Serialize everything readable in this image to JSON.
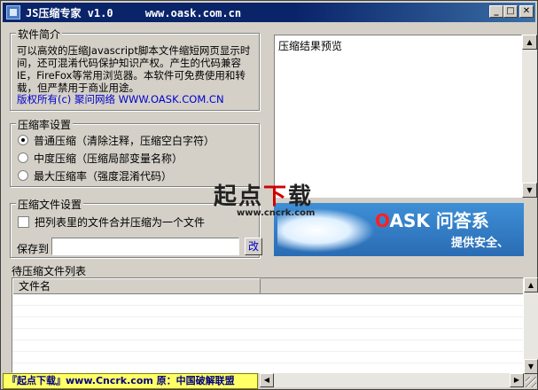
{
  "window": {
    "title": "JS压缩专家 v1.0     www.oask.com.cn",
    "controls": {
      "minimize": "_",
      "maximize": "□",
      "close": "✕"
    }
  },
  "intro": {
    "group_title": "软件简介",
    "text": "可以高效的压缩Javascript脚本文件缩短网页显示时间，还可混淆代码保护知识产权。产生的代码兼容IE，FireFox等常用浏览器。本软件可免费使用和转载，但严禁用于商业用途。",
    "copyright": "版权所有(c) 聚问网络 WWW.OASK.COM.CN"
  },
  "compression": {
    "group_title": "压缩率设置",
    "options": [
      {
        "label": "普通压缩（清除注释，压缩空白字符）",
        "selected": true
      },
      {
        "label": "中度压缩（压缩局部变量名称）",
        "selected": false
      },
      {
        "label": "最大压缩率（强度混淆代码）",
        "selected": false
      }
    ]
  },
  "file_settings": {
    "group_title": "压缩文件设置",
    "merge_label": "把列表里的文件合并压缩为一个文件",
    "merge_checked": false,
    "save_to_label": "保存到",
    "save_to_value": "",
    "change_button": "改"
  },
  "preview": {
    "label": "压缩结果预览"
  },
  "banner": {
    "brand_prefix": "O",
    "brand_rest": "ASK 问答系",
    "subtitle": "提供安全、"
  },
  "watermark": {
    "part1": "起点",
    "part2": "下",
    "part3": "载",
    "url": "www.cncrk.com"
  },
  "file_list": {
    "label": "待压缩文件列表",
    "columns": [
      "文件名"
    ],
    "rows": []
  },
  "footer": {
    "stamp": "『起点下载』www.Cncrk.com 原：中国破解联盟"
  },
  "colors": {
    "title_bar": "#0a246a",
    "link_blue": "#0000cc",
    "banner_blue": "#3e8fd6",
    "stamp_yellow": "#ffff66"
  }
}
